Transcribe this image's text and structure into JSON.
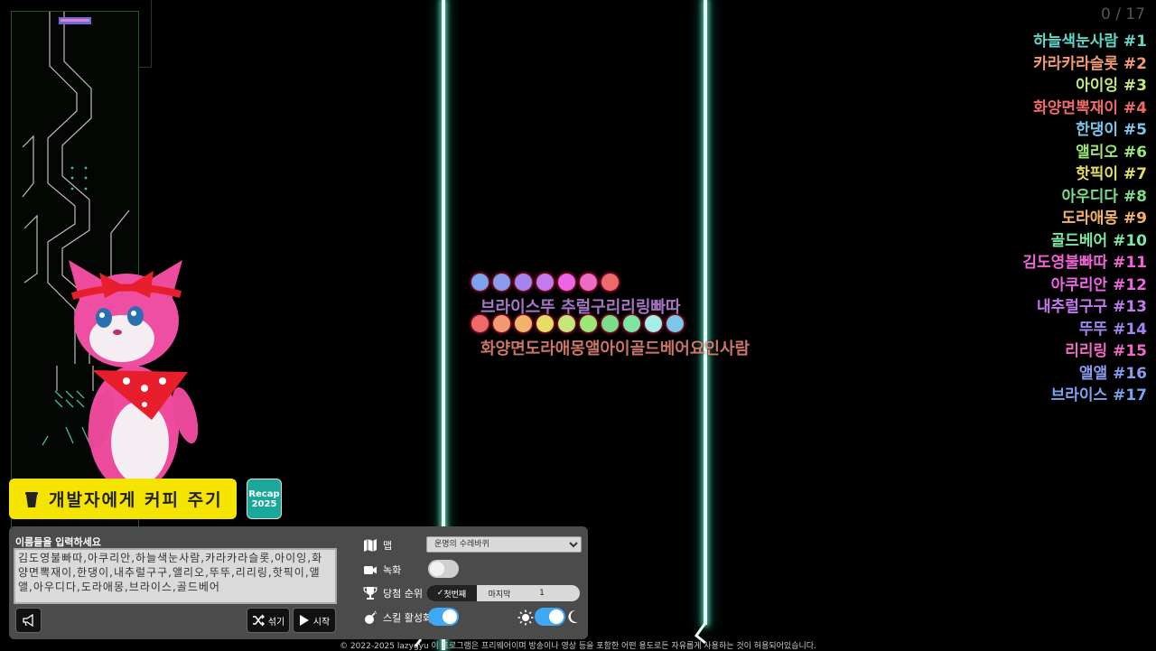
{
  "counter": "0 / 17",
  "ranking": [
    {
      "label": "하늘색눈사람 #1",
      "color": "#5fd6c8"
    },
    {
      "label": "카라카라슬롯 #2",
      "color": "#f29a72"
    },
    {
      "label": "아이잉 #3",
      "color": "#c4e87a"
    },
    {
      "label": "화양면뽁재이 #4",
      "color": "#ee6a6a"
    },
    {
      "label": "한댕이 #5",
      "color": "#7cc6ea"
    },
    {
      "label": "앨리오 #6",
      "color": "#9be675"
    },
    {
      "label": "핫픽이 #7",
      "color": "#e6de62"
    },
    {
      "label": "아우디다 #8",
      "color": "#7ade8a"
    },
    {
      "label": "도라애몽 #9",
      "color": "#f2b46a"
    },
    {
      "label": "골드베어 #10",
      "color": "#7ce6a4"
    },
    {
      "label": "김도영불빠따 #11",
      "color": "#ee64d6"
    },
    {
      "label": "아쿠리안 #12",
      "color": "#ee64e6"
    },
    {
      "label": "내추럴구구 #13",
      "color": "#c27aee"
    },
    {
      "label": "뚜뚜 #14",
      "color": "#a484ee"
    },
    {
      "label": "리리링 #15",
      "color": "#ee6ac4"
    },
    {
      "label": "앨앨 #16",
      "color": "#8a9cee"
    },
    {
      "label": "브라이스 #17",
      "color": "#7aa2ee"
    }
  ],
  "marble_labels": {
    "top": "브라이스뚜 추럴구리리링빠따",
    "bottom": "화양면도라애몽앨아이골드베어요인사람"
  },
  "coffee_button": "개발자에게 커피 주기",
  "recap_button": {
    "line1": "Recap",
    "line2": "2025"
  },
  "panel": {
    "names_label": "이름들을 입력하세요",
    "names_value": "김도영불빠따,아쿠리안,하늘색눈사람,카라카라슬롯,아이잉,화양면뽁재이,한댕이,내추럴구구,앨리오,뚜뚜,리리링,핫픽이,앨앨,아우디다,도라애몽,브라이스,골드베어",
    "shuffle_label": "섞기",
    "start_label": "시작",
    "map_label": "맵",
    "map_value": "운명의 수레바퀴",
    "record_label": "녹화",
    "rank_label": "당첨 순위",
    "rank_first": "첫번째",
    "rank_last": "마지막",
    "rank_number": "1",
    "skill_label": "스킬 활성화"
  },
  "footer": "© 2022-2025 lazygyu 이 프로그램은 프리웨어이며 방송이나 영상 등을 포함한 어떤 용도로든 자유롭게 사용하는 것이 허용되어있습니다."
}
